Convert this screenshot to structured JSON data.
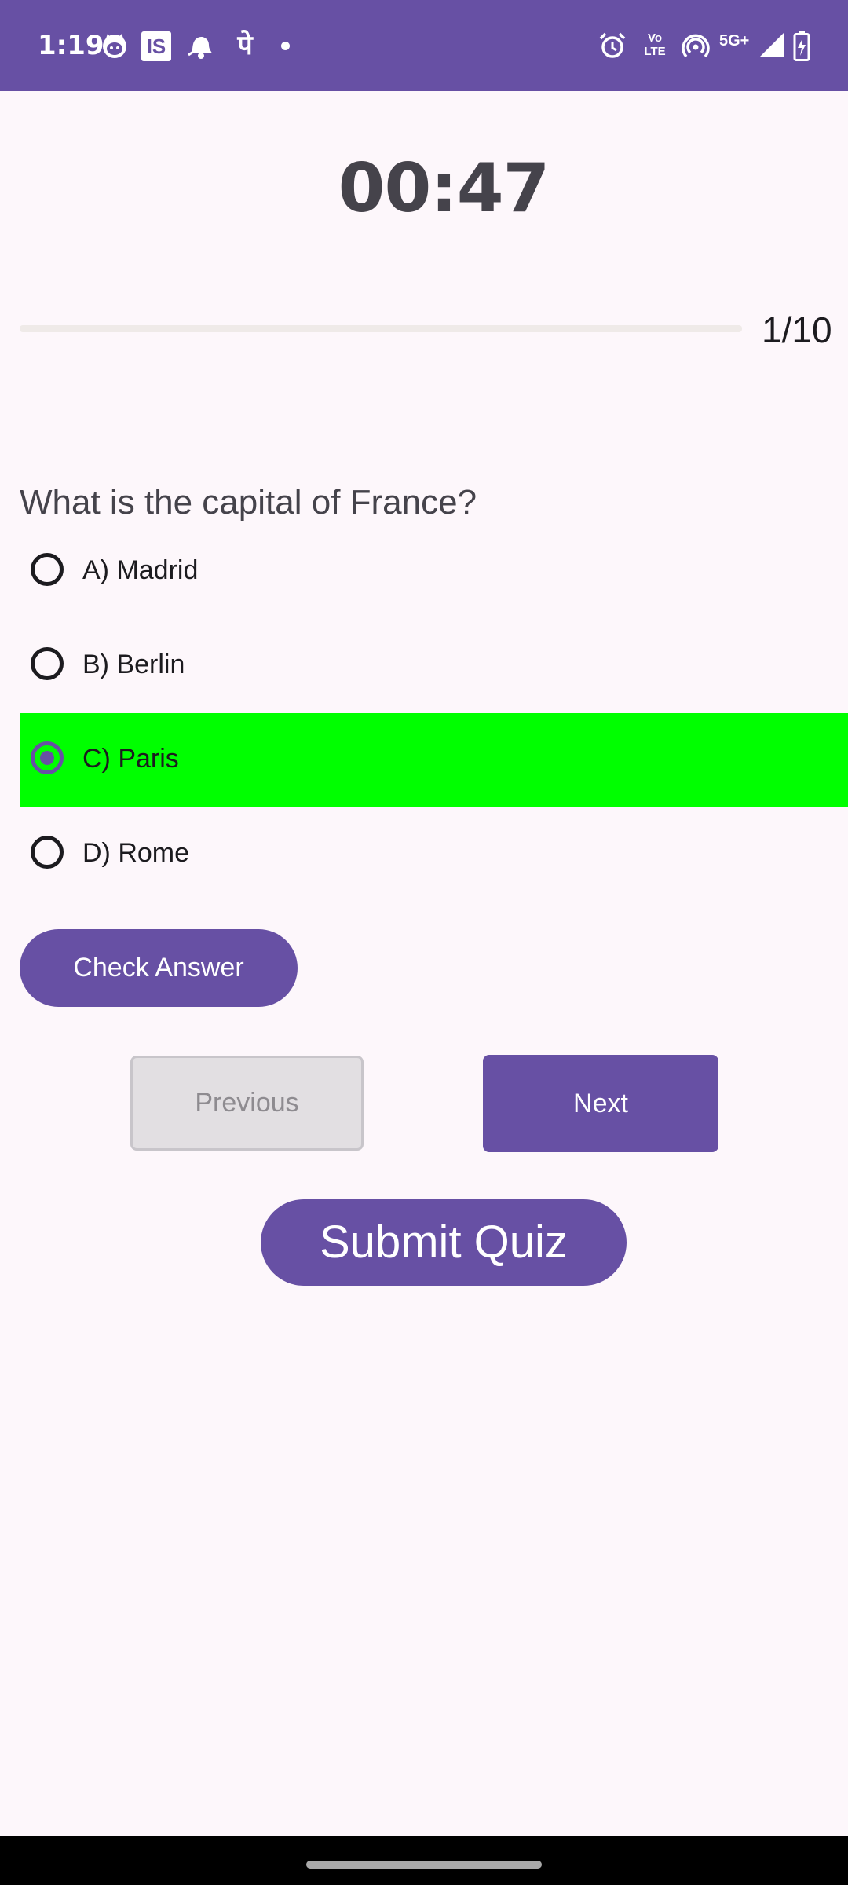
{
  "status_bar": {
    "time": "1:19",
    "app_icons": [
      "cat-face-icon",
      "is-box-icon",
      "bell-icon",
      "pe-icon",
      "dot-icon"
    ],
    "pe_glyph": "पे",
    "is_glyph": "IS",
    "system_icons": [
      "alarm-icon",
      "volte-icon",
      "hotspot-icon",
      "5g-plus-icon",
      "signal-icon",
      "battery-charging-icon"
    ],
    "volte_text": "Vo LTE",
    "network_text": "5G+"
  },
  "quiz": {
    "timer": "00:47",
    "progress_label": "1/10",
    "progress_value": 0.0,
    "question": "What is the capital of France?",
    "options": [
      {
        "label": "A) Madrid",
        "selected": false
      },
      {
        "label": "B) Berlin",
        "selected": false
      },
      {
        "label": "C) Paris",
        "selected": true
      },
      {
        "label": "D) Rome",
        "selected": false
      }
    ],
    "check_answer_label": "Check Answer",
    "previous_label": "Previous",
    "next_label": "Next",
    "submit_label": "Submit Quiz"
  },
  "colors": {
    "primary": "#6750a4",
    "correct_highlight": "#00ff00",
    "background": "#fdf7fb"
  }
}
